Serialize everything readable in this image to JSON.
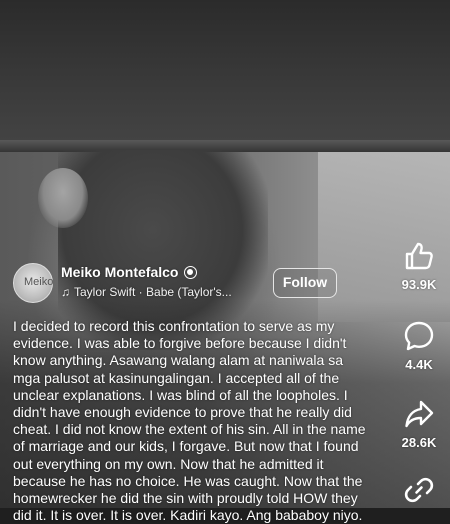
{
  "creator": {
    "avatar_text": "Meiko",
    "name": "Meiko Montefalco",
    "music": "Taylor Swift · Babe (Taylor's..."
  },
  "follow_label": "Follow",
  "caption": "I decided to record this confrontation to serve as my\nevidence. I was able to forgive before because I didn't\nknow anything. Asawang walang alam at naniwala sa\nmga palusot at kasinungalingan. I accepted all of the\nunclear explanations. I was blind of all the loopholes. I\ndidn't have enough evidence to prove that he really did\ncheat. I did not know the extent of his sin. All in the name\nof marriage and our kids, I forgave. But now that I found\nout everything on my own. Now that he admitted it\nbecause he has no choice. He was caught. Now that the\nhomewrecker he did the sin with proudly told HOW they\ndid it. It is over. It is over. Kadiri kayo. Ang bababoy niyo.",
  "actions": {
    "like_count": "93.9K",
    "comment_count": "4.4K",
    "share_count": "28.6K"
  },
  "icons": {
    "like": "thumbs-up-icon",
    "comment": "comment-bubble-icon",
    "share": "share-arrow-icon",
    "link": "link-icon",
    "verified": "verified-badge-icon",
    "music": "music-note-icon"
  }
}
